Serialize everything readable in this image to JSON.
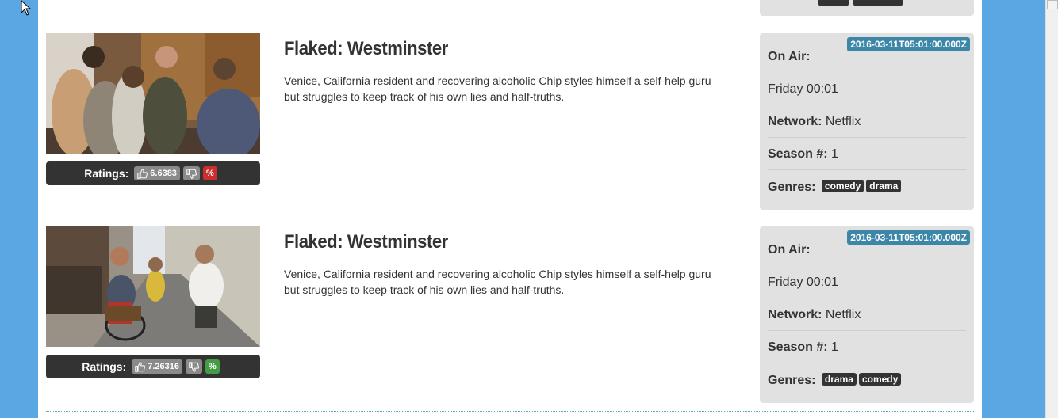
{
  "episodes": [
    {
      "title": "Flaked: Westminster",
      "description": "Venice, California resident and recovering alcoholic Chip styles himself a self-help guru but struggles to keep track of his own lies and half-truths.",
      "ratings_label": "Ratings:",
      "rating_value": "6.6383",
      "percent_label": "%",
      "percent_color": "#c9302c",
      "airdate": "2016-03-11T05:01:00.000Z",
      "on_air_label": "On Air:",
      "on_air_value": "Friday 00:01",
      "network_label": "Network:",
      "network_value": "Netflix",
      "season_label": "Season #:",
      "season_value": "1",
      "genres_label": "Genres:",
      "genres": [
        "comedy",
        "drama"
      ]
    },
    {
      "title": "Flaked: Westminster",
      "description": "Venice, California resident and recovering alcoholic Chip styles himself a self-help guru but struggles to keep track of his own lies and half-truths.",
      "ratings_label": "Ratings:",
      "rating_value": "7.26316",
      "percent_label": "%",
      "percent_color": "#449d44",
      "airdate": "2016-03-11T05:01:00.000Z",
      "on_air_label": "On Air:",
      "on_air_value": "Friday 00:01",
      "network_label": "Network:",
      "network_value": "Netflix",
      "season_label": "Season #:",
      "season_value": "1",
      "genres_label": "Genres:",
      "genres": [
        "drama",
        "comedy"
      ]
    }
  ],
  "icons": {
    "like": "thumbs-up-icon",
    "dislike": "thumbs-down-icon",
    "cursor": "mouse-pointer-icon"
  },
  "colors": {
    "page_background": "#5aa7e3",
    "badge_blue": "#3c86a8",
    "dark": "#333333"
  }
}
